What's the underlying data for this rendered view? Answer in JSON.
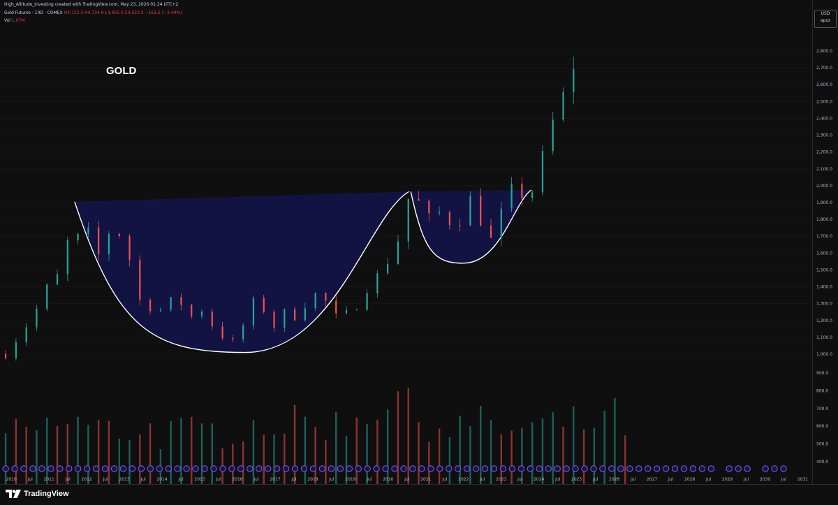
{
  "header": {
    "top_line": "High_Altitude_Investing created with TradingView.com, May 23, 2026 01:24 UTC+2",
    "symbol_line": "Gold Futures · 10D · COMEX",
    "ohlc": "O4,722.3  H4,734.8  L4,455.0  C4,523.2  −161.5 (−3.49%)",
    "vol_label": "Vol",
    "vol_value": "1.07M"
  },
  "annotation": {
    "title": "GOLD"
  },
  "axis": {
    "currency": "USD",
    "mode": "apoz"
  },
  "footer": {
    "brand": "TradingView"
  },
  "colors": {
    "up": "#26a69a",
    "down": "#ef5350",
    "pattern_fill": "#141447",
    "pattern_stroke": "#ffffff",
    "background": "#0f0f0f"
  },
  "chart_data": {
    "type": "candlestick",
    "title": "GOLD",
    "price_ticks": [
      1000,
      1100,
      1200,
      1300,
      1400,
      1500,
      1600,
      1700,
      1800,
      1900,
      2000,
      2100,
      2200,
      2300,
      2400,
      2500,
      2600,
      2700,
      2800
    ],
    "price_tick_labels": [
      "1,000.0",
      "1,100.0",
      "1,200.0",
      "1,300.0",
      "1,400.0",
      "1,500.0",
      "1,600.0",
      "1,700.0",
      "1,800.0",
      "1,900.0",
      "2,000.0",
      "2,100.0",
      "2,200.0",
      "2,300.0",
      "2,400.0",
      "2,500.0",
      "2,600.0",
      "2,700.0",
      "2,800.0"
    ],
    "volume_ticks": [
      400,
      500,
      600,
      700,
      800,
      900
    ],
    "volume_tick_labels": [
      "400.0",
      "500.0",
      "600.0",
      "700.0",
      "800.0",
      "900.0"
    ],
    "x_ticks": [
      2010,
      2010.5,
      2011,
      2011.5,
      2012,
      2012.5,
      2013,
      2013.5,
      2014,
      2014.5,
      2015,
      2015.5,
      2016,
      2016.5,
      2017,
      2017.5,
      2018,
      2018.5,
      2019,
      2019.5,
      2020,
      2020.5,
      2021,
      2021.5,
      2022,
      2022.5,
      2023,
      2023.5,
      2024,
      2024.5,
      2025,
      2025.5,
      2026,
      2026.5,
      2027,
      2027.5,
      2028,
      2028.5,
      2029,
      2029.5,
      2030,
      2030.5,
      2031
    ],
    "x_tick_labels": [
      "2010",
      "Jul",
      "2011",
      "Jul",
      "2012",
      "Jul",
      "2013",
      "Jul",
      "2014",
      "Jul",
      "2015",
      "Jul",
      "2016",
      "Jul",
      "2017",
      "Jul",
      "2018",
      "Jul",
      "2019",
      "Jul",
      "2020",
      "Jul",
      "2021",
      "Jul",
      "2022",
      "Jul",
      "2023",
      "Jul",
      "2024",
      "Jul",
      "2025",
      "Jul",
      "2026",
      "Jul",
      "2027",
      "Jul",
      "2028",
      "Jul",
      "2029",
      "Jul",
      "2030",
      "Jul",
      "2031"
    ],
    "price_path": [
      [
        2009.85,
        1000
      ],
      [
        2010.2,
        1110
      ],
      [
        2010.6,
        1230
      ],
      [
        2010.9,
        1380
      ],
      [
        2011.3,
        1480
      ],
      [
        2011.6,
        1760
      ],
      [
        2011.68,
        1880
      ],
      [
        2011.8,
        1620
      ],
      [
        2012.0,
        1740
      ],
      [
        2012.3,
        1580
      ],
      [
        2012.7,
        1780
      ],
      [
        2012.9,
        1700
      ],
      [
        2013.1,
        1600
      ],
      [
        2013.3,
        1420
      ],
      [
        2013.5,
        1240
      ],
      [
        2013.8,
        1310
      ],
      [
        2014.0,
        1250
      ],
      [
        2014.3,
        1330
      ],
      [
        2014.6,
        1290
      ],
      [
        2014.9,
        1180
      ],
      [
        2015.1,
        1290
      ],
      [
        2015.3,
        1180
      ],
      [
        2015.6,
        1110
      ],
      [
        2015.95,
        1060
      ],
      [
        2016.3,
        1250
      ],
      [
        2016.55,
        1360
      ],
      [
        2016.9,
        1140
      ],
      [
        2017.2,
        1250
      ],
      [
        2017.5,
        1220
      ],
      [
        2017.8,
        1300
      ],
      [
        2018.1,
        1360
      ],
      [
        2018.4,
        1300
      ],
      [
        2018.7,
        1190
      ],
      [
        2018.9,
        1240
      ],
      [
        2019.2,
        1300
      ],
      [
        2019.5,
        1420
      ],
      [
        2019.8,
        1480
      ],
      [
        2020.0,
        1560
      ],
      [
        2020.2,
        1650
      ],
      [
        2020.45,
        1770
      ],
      [
        2020.6,
        2040
      ],
      [
        2020.8,
        1900
      ],
      [
        2021.0,
        1860
      ],
      [
        2021.2,
        1720
      ],
      [
        2021.4,
        1870
      ],
      [
        2021.6,
        1790
      ],
      [
        2021.9,
        1800
      ],
      [
        2022.2,
        1930
      ],
      [
        2022.35,
        1850
      ],
      [
        2022.6,
        1720
      ],
      [
        2022.8,
        1650
      ],
      [
        2023.1,
        1920
      ],
      [
        2023.35,
        1990
      ],
      [
        2023.6,
        1940
      ],
      [
        2023.8,
        1960
      ],
      [
        2024.0,
        2050
      ],
      [
        2024.25,
        2350
      ],
      [
        2024.55,
        2420
      ],
      [
        2024.75,
        2650
      ],
      [
        2024.9,
        2700
      ],
      [
        2025.05,
        2850
      ],
      [
        2025.15,
        3000
      ]
    ],
    "volume_profile": [
      [
        2009.85,
        520
      ],
      [
        2010.5,
        560
      ],
      [
        2011.0,
        580
      ],
      [
        2011.6,
        620
      ],
      [
        2012.2,
        570
      ],
      [
        2012.8,
        560
      ],
      [
        2013.4,
        590
      ],
      [
        2014.0,
        550
      ],
      [
        2014.8,
        540
      ],
      [
        2015.5,
        560
      ],
      [
        2016.0,
        590
      ],
      [
        2016.8,
        610
      ],
      [
        2017.5,
        600
      ],
      [
        2018.2,
        610
      ],
      [
        2018.8,
        600
      ],
      [
        2019.4,
        660
      ],
      [
        2019.9,
        720
      ],
      [
        2020.3,
        780
      ],
      [
        2020.7,
        640
      ],
      [
        2021.2,
        600
      ],
      [
        2021.8,
        580
      ],
      [
        2022.3,
        610
      ],
      [
        2022.9,
        580
      ],
      [
        2023.4,
        560
      ],
      [
        2024.0,
        580
      ],
      [
        2024.6,
        600
      ],
      [
        2025.1,
        600
      ],
      [
        2025.6,
        620
      ],
      [
        2026.0,
        650
      ],
      [
        2026.3,
        600
      ]
    ],
    "cup": {
      "left": [
        2011.68,
        1905
      ],
      "bottom": [
        2016.2,
        1010
      ],
      "right": [
        2020.55,
        1965
      ]
    },
    "handle": {
      "left": [
        2020.6,
        1965
      ],
      "bottom": [
        2022.0,
        1540
      ],
      "right": [
        2023.8,
        1975
      ]
    }
  }
}
